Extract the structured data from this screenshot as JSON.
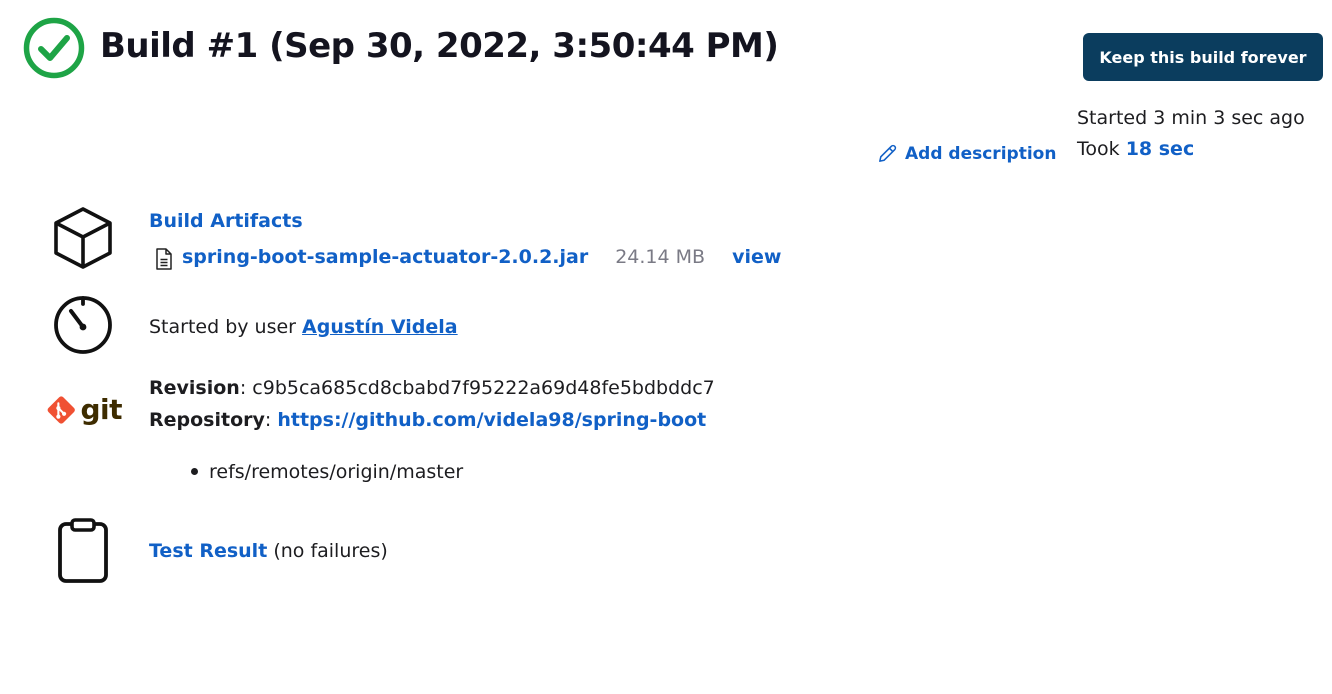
{
  "header": {
    "title": "Build #1 (Sep 30, 2022, 3:50:44 PM)",
    "status_icon": "check-circle-icon",
    "status_color": "#1ea446",
    "keep_button_label": "Keep this build forever",
    "started_text": "Started 3 min 3 sec ago",
    "took_prefix": "Took",
    "took_value": "18 sec",
    "add_description_label": "Add description"
  },
  "artifacts": {
    "title": "Build Artifacts",
    "icon": "package-box-icon",
    "items": [
      {
        "file_name": "spring-boot-sample-actuator-2.0.2.jar",
        "size": "24.14 MB",
        "view_label": "view"
      }
    ]
  },
  "cause": {
    "icon": "timer-icon",
    "prefix": "Started by user",
    "user": "Agustín Videla"
  },
  "git": {
    "icon": "git-logo-icon",
    "logo_text": "git",
    "revision_label": "Revision",
    "revision_value": "c9b5ca685cd8cbabd7f95222a69d48fe5bdbddc7",
    "repository_label": "Repository",
    "repository_url": "https://github.com/videla98/spring-boot",
    "branches": [
      "refs/remotes/origin/master"
    ]
  },
  "tests": {
    "icon": "clipboard-icon",
    "link_label": "Test Result",
    "summary": "(no failures)"
  },
  "colors": {
    "link": "#1160c6",
    "button_bg": "#0b3d5e",
    "git_orange": "#f05133"
  }
}
